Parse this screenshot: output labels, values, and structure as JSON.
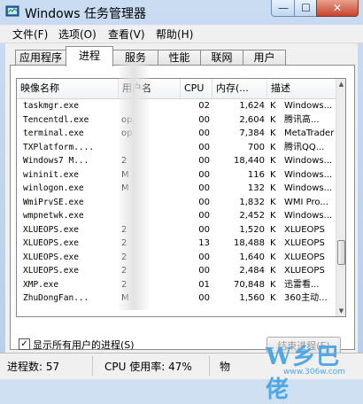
{
  "window": {
    "title": "Windows 任务管理器",
    "minimize_label": "—",
    "maximize_label": "☐",
    "close_label": "✕"
  },
  "menu": [
    {
      "label": "文件(F)"
    },
    {
      "label": "选项(O)"
    },
    {
      "label": "查看(V)"
    },
    {
      "label": "帮助(H)"
    }
  ],
  "tabs": [
    {
      "label": "应用程序",
      "active": false
    },
    {
      "label": "进程",
      "active": true
    },
    {
      "label": "服务",
      "active": false
    },
    {
      "label": "性能",
      "active": false
    },
    {
      "label": "联网",
      "active": false
    },
    {
      "label": "用户",
      "active": false
    }
  ],
  "columns": {
    "name": "映像名称",
    "user": "用户名",
    "cpu": "CPU",
    "mem": "内存(...",
    "desc": "描述"
  },
  "processes": [
    {
      "name": "taskmgr.exe",
      "user": "",
      "cpu": "02",
      "mem": "1,624",
      "unit": "K",
      "desc": "Windows..."
    },
    {
      "name": "Tencentdl.exe",
      "user": "op",
      "cpu": "00",
      "mem": "2,604",
      "unit": "K",
      "desc": "腾讯高..."
    },
    {
      "name": "terminal.exe",
      "user": "op",
      "cpu": "00",
      "mem": "7,384",
      "unit": "K",
      "desc": "MetaTrader"
    },
    {
      "name": "TXPlatform....",
      "user": "",
      "cpu": "00",
      "mem": "700",
      "unit": "K",
      "desc": "腾讯QQ..."
    },
    {
      "name": "Windows7 M...",
      "user": "2",
      "cpu": "00",
      "mem": "18,440",
      "unit": "K",
      "desc": "Windows..."
    },
    {
      "name": "wininit.exe",
      "user": "M",
      "cpu": "00",
      "mem": "116",
      "unit": "K",
      "desc": "Windows..."
    },
    {
      "name": "winlogon.exe",
      "user": "M",
      "cpu": "00",
      "mem": "132",
      "unit": "K",
      "desc": "Windows..."
    },
    {
      "name": "WmiPrvSE.exe",
      "user": "",
      "cpu": "00",
      "mem": "1,832",
      "unit": "K",
      "desc": "WMI Pro..."
    },
    {
      "name": "wmpnetwk.exe",
      "user": "",
      "cpu": "00",
      "mem": "2,452",
      "unit": "K",
      "desc": "Windows..."
    },
    {
      "name": "XLUEOPS.exe",
      "user": "2",
      "cpu": "00",
      "mem": "1,520",
      "unit": "K",
      "desc": "XLUEOPS"
    },
    {
      "name": "XLUEOPS.exe",
      "user": "2",
      "cpu": "13",
      "mem": "18,488",
      "unit": "K",
      "desc": "XLUEOPS"
    },
    {
      "name": "XLUEOPS.exe",
      "user": "2",
      "cpu": "00",
      "mem": "1,640",
      "unit": "K",
      "desc": "XLUEOPS"
    },
    {
      "name": "XLUEOPS.exe",
      "user": "2",
      "cpu": "00",
      "mem": "2,484",
      "unit": "K",
      "desc": "XLUEOPS"
    },
    {
      "name": "XMP.exe",
      "user": "2",
      "cpu": "01",
      "mem": "70,848",
      "unit": "K",
      "desc": "迅雷看..."
    },
    {
      "name": "ZhuDongFan...",
      "user": "M",
      "cpu": "00",
      "mem": "1,560",
      "unit": "K",
      "desc": "360主动..."
    }
  ],
  "show_all_users": {
    "label": "显示所有用户的进程(S)",
    "checked": true
  },
  "end_process_label": "结束进程(E)",
  "status": {
    "processes": "进程数: 57",
    "cpu": "CPU 使用率: 47%",
    "mem": "物"
  },
  "watermark": {
    "text": "W乡巴佬",
    "url": "www.306w.com"
  }
}
